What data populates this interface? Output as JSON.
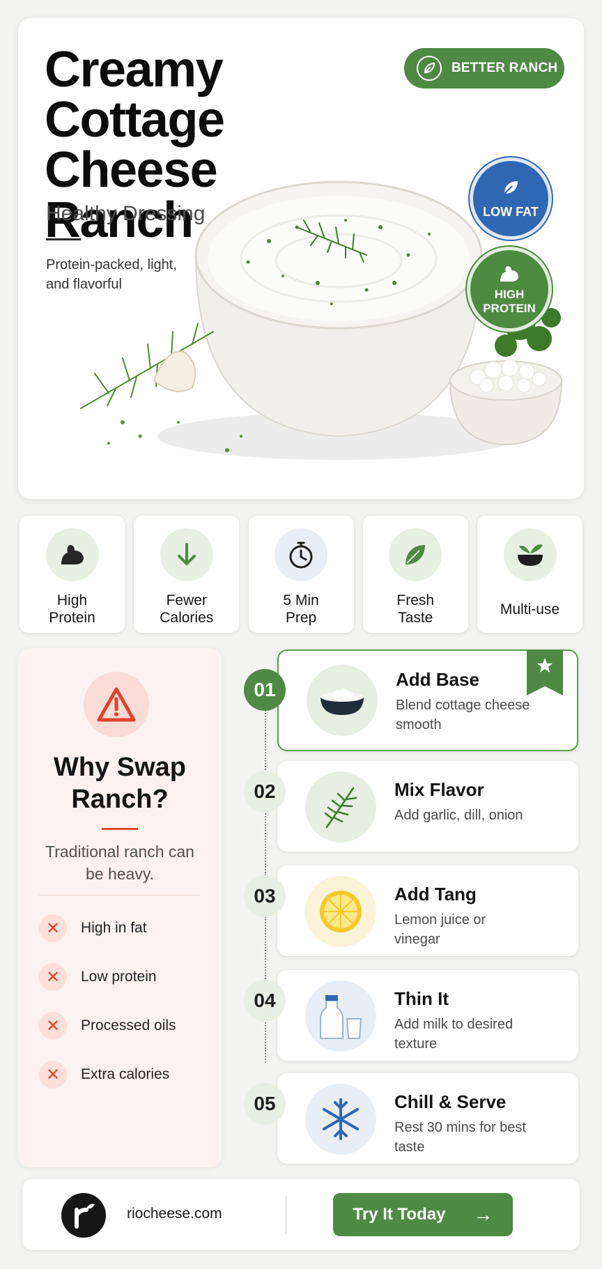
{
  "hero": {
    "title_lines": [
      "Creamy",
      "Cottage Cheese",
      "Ranch"
    ],
    "subtitle": "Healthy Dressing",
    "tagline": "Protein-packed, light, and flavorful",
    "pill_label": "BETTER RANCH",
    "badge_low_fat": "LOW FAT",
    "badge_high_protein": "HIGH PROTEIN"
  },
  "features": [
    {
      "label": "High\nProtein",
      "icon": "flexed-bicep-icon"
    },
    {
      "label": "Fewer\nCalories",
      "icon": "arrow-down-icon"
    },
    {
      "label": "5 Min\nPrep",
      "icon": "stopwatch-icon"
    },
    {
      "label": "Fresh\nTaste",
      "icon": "leaf-icon"
    },
    {
      "label": "Multi-use",
      "icon": "bowl-sprout-icon"
    }
  ],
  "why": {
    "title": "Why Swap Ranch?",
    "description": "Traditional ranch can be heavy.",
    "items": [
      "High in fat",
      "Low protein",
      "Processed oils",
      "Extra calories"
    ]
  },
  "steps": [
    {
      "number": "01",
      "title": "Add Base",
      "description": "Blend cottage cheese smooth",
      "icon": "cottage-cheese-bowl-icon"
    },
    {
      "number": "02",
      "title": "Mix Flavor",
      "description": "Add garlic, dill, onion",
      "icon": "dill-sprig-icon"
    },
    {
      "number": "03",
      "title": "Add Tang",
      "description": "Lemon juice or vinegar",
      "icon": "lemon-icon"
    },
    {
      "number": "04",
      "title": "Thin It",
      "description": "Add milk to desired texture",
      "icon": "milk-bottle-icon"
    },
    {
      "number": "05",
      "title": "Chill & Serve",
      "description": "Rest 30 mins for best taste",
      "icon": "snowflake-icon"
    }
  ],
  "footer": {
    "url": "riocheese.com",
    "cta_label": "Try It Today",
    "cta_arrow": "→"
  },
  "colors": {
    "brand_green": "#4e8a44",
    "low_fat_blue": "#2f67b3",
    "alert_red": "#e0432c"
  }
}
